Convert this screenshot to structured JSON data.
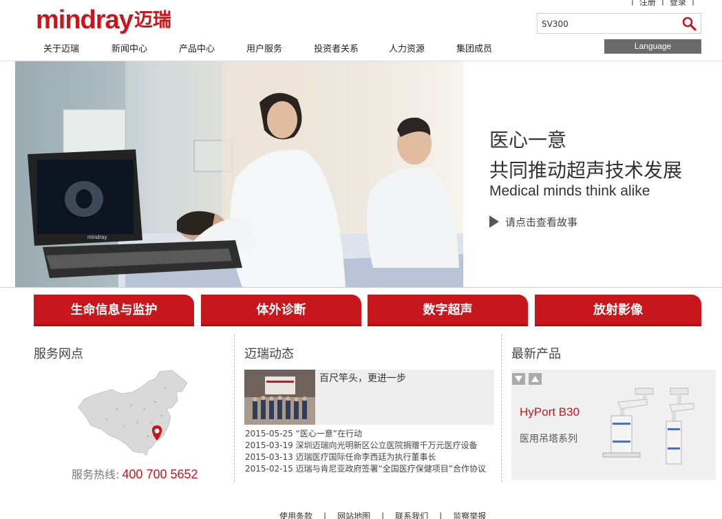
{
  "brand": {
    "logo_en": "mindray",
    "logo_cn": "迈瑞",
    "color": "#c8161d"
  },
  "toplinks": {
    "register": "注册",
    "login": "登录"
  },
  "search": {
    "value": "SV300",
    "icon": "search-icon"
  },
  "nav": {
    "items": [
      "关于迈瑞",
      "新闻中心",
      "产品中心",
      "用户服务",
      "投资者关系",
      "人力资源",
      "集团成员"
    ],
    "language": "Language"
  },
  "banner": {
    "line1": "医心一意",
    "line2": "共同推动超声技术发展",
    "line3": "Medical minds think alike",
    "more": "请点击查看故事",
    "device_brand": "mindray"
  },
  "categories": [
    "生命信息与监护",
    "体外诊断",
    "数字超声",
    "放射影像"
  ],
  "service": {
    "title": "服务网点",
    "hotline_label": "服务热线:",
    "hotline": "400 700 5652"
  },
  "news": {
    "title": "迈瑞动态",
    "headline": "百尺竿头，更进一步",
    "items": [
      "2015-05-25 “医心一意”在行动",
      "2015-03-19 深圳迈瑞向光明新区公立医院捐赠千万元医疗设备",
      "2015-03-13 迈瑞医疗国际任命李西廷为执行董事长",
      "2015-02-15 迈瑞与肯尼亚政府签署“全国医疗保健项目”合作协议"
    ]
  },
  "product": {
    "title": "最新产品",
    "name": "HyPort B30",
    "subtitle": "医用吊塔系列"
  },
  "footer": {
    "links": [
      "使用条款",
      "网站地图",
      "联系我们",
      "监察举报"
    ]
  }
}
